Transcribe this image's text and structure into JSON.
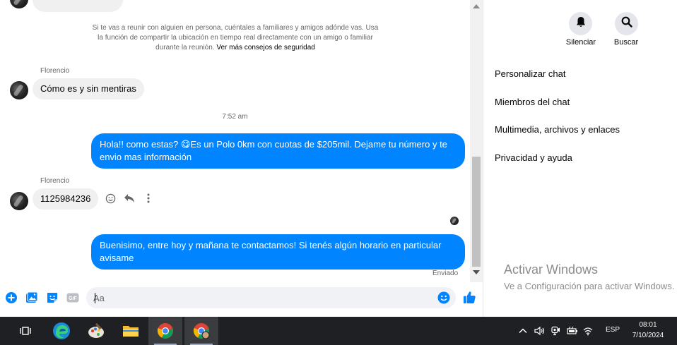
{
  "chat": {
    "safety_notice": "Si te vas a reunir con alguien en persona, cuéntales a familiares y amigos adónde vas. Usa la función de compartir la ubicación en tiempo real directamente con un amigo o familiar durante la reunión.",
    "safety_link": "Ver más consejos de seguridad",
    "messages": [
      {
        "sender": "Florencio",
        "text": "Cómo es y sin mentiras"
      },
      {
        "time": "7:52 am"
      },
      {
        "text": "Hola!! como estas? 😋Es un Polo 0km con cuotas de $205mil. Dejame tu número y te envio mas información"
      },
      {
        "sender": "Florencio",
        "text": "1125984236"
      },
      {
        "text": "Buenisimo, entre hoy y mañana te contactamos! Si tenés algún horario en particular avisame",
        "status": "Enviado"
      }
    ],
    "composer_placeholder": "Aa"
  },
  "panel": {
    "buttons": [
      {
        "label": "Silenciar",
        "icon": "bell-icon"
      },
      {
        "label": "Buscar",
        "icon": "search-icon"
      }
    ],
    "menu": [
      "Personalizar chat",
      "Miembros del chat",
      "Multimedia, archivos y enlaces",
      "Privacidad y ayuda"
    ],
    "watermark_title": "Activar Windows",
    "watermark_sub": "Ve a Configuración para activar Windows."
  },
  "taskbar": {
    "lang": "ESP",
    "time": "08:01",
    "date": "7/10/2024"
  },
  "colors": {
    "messenger_blue": "#0084ff",
    "bubble_gray": "#f0f0f0",
    "taskbar": "#1f2023"
  }
}
